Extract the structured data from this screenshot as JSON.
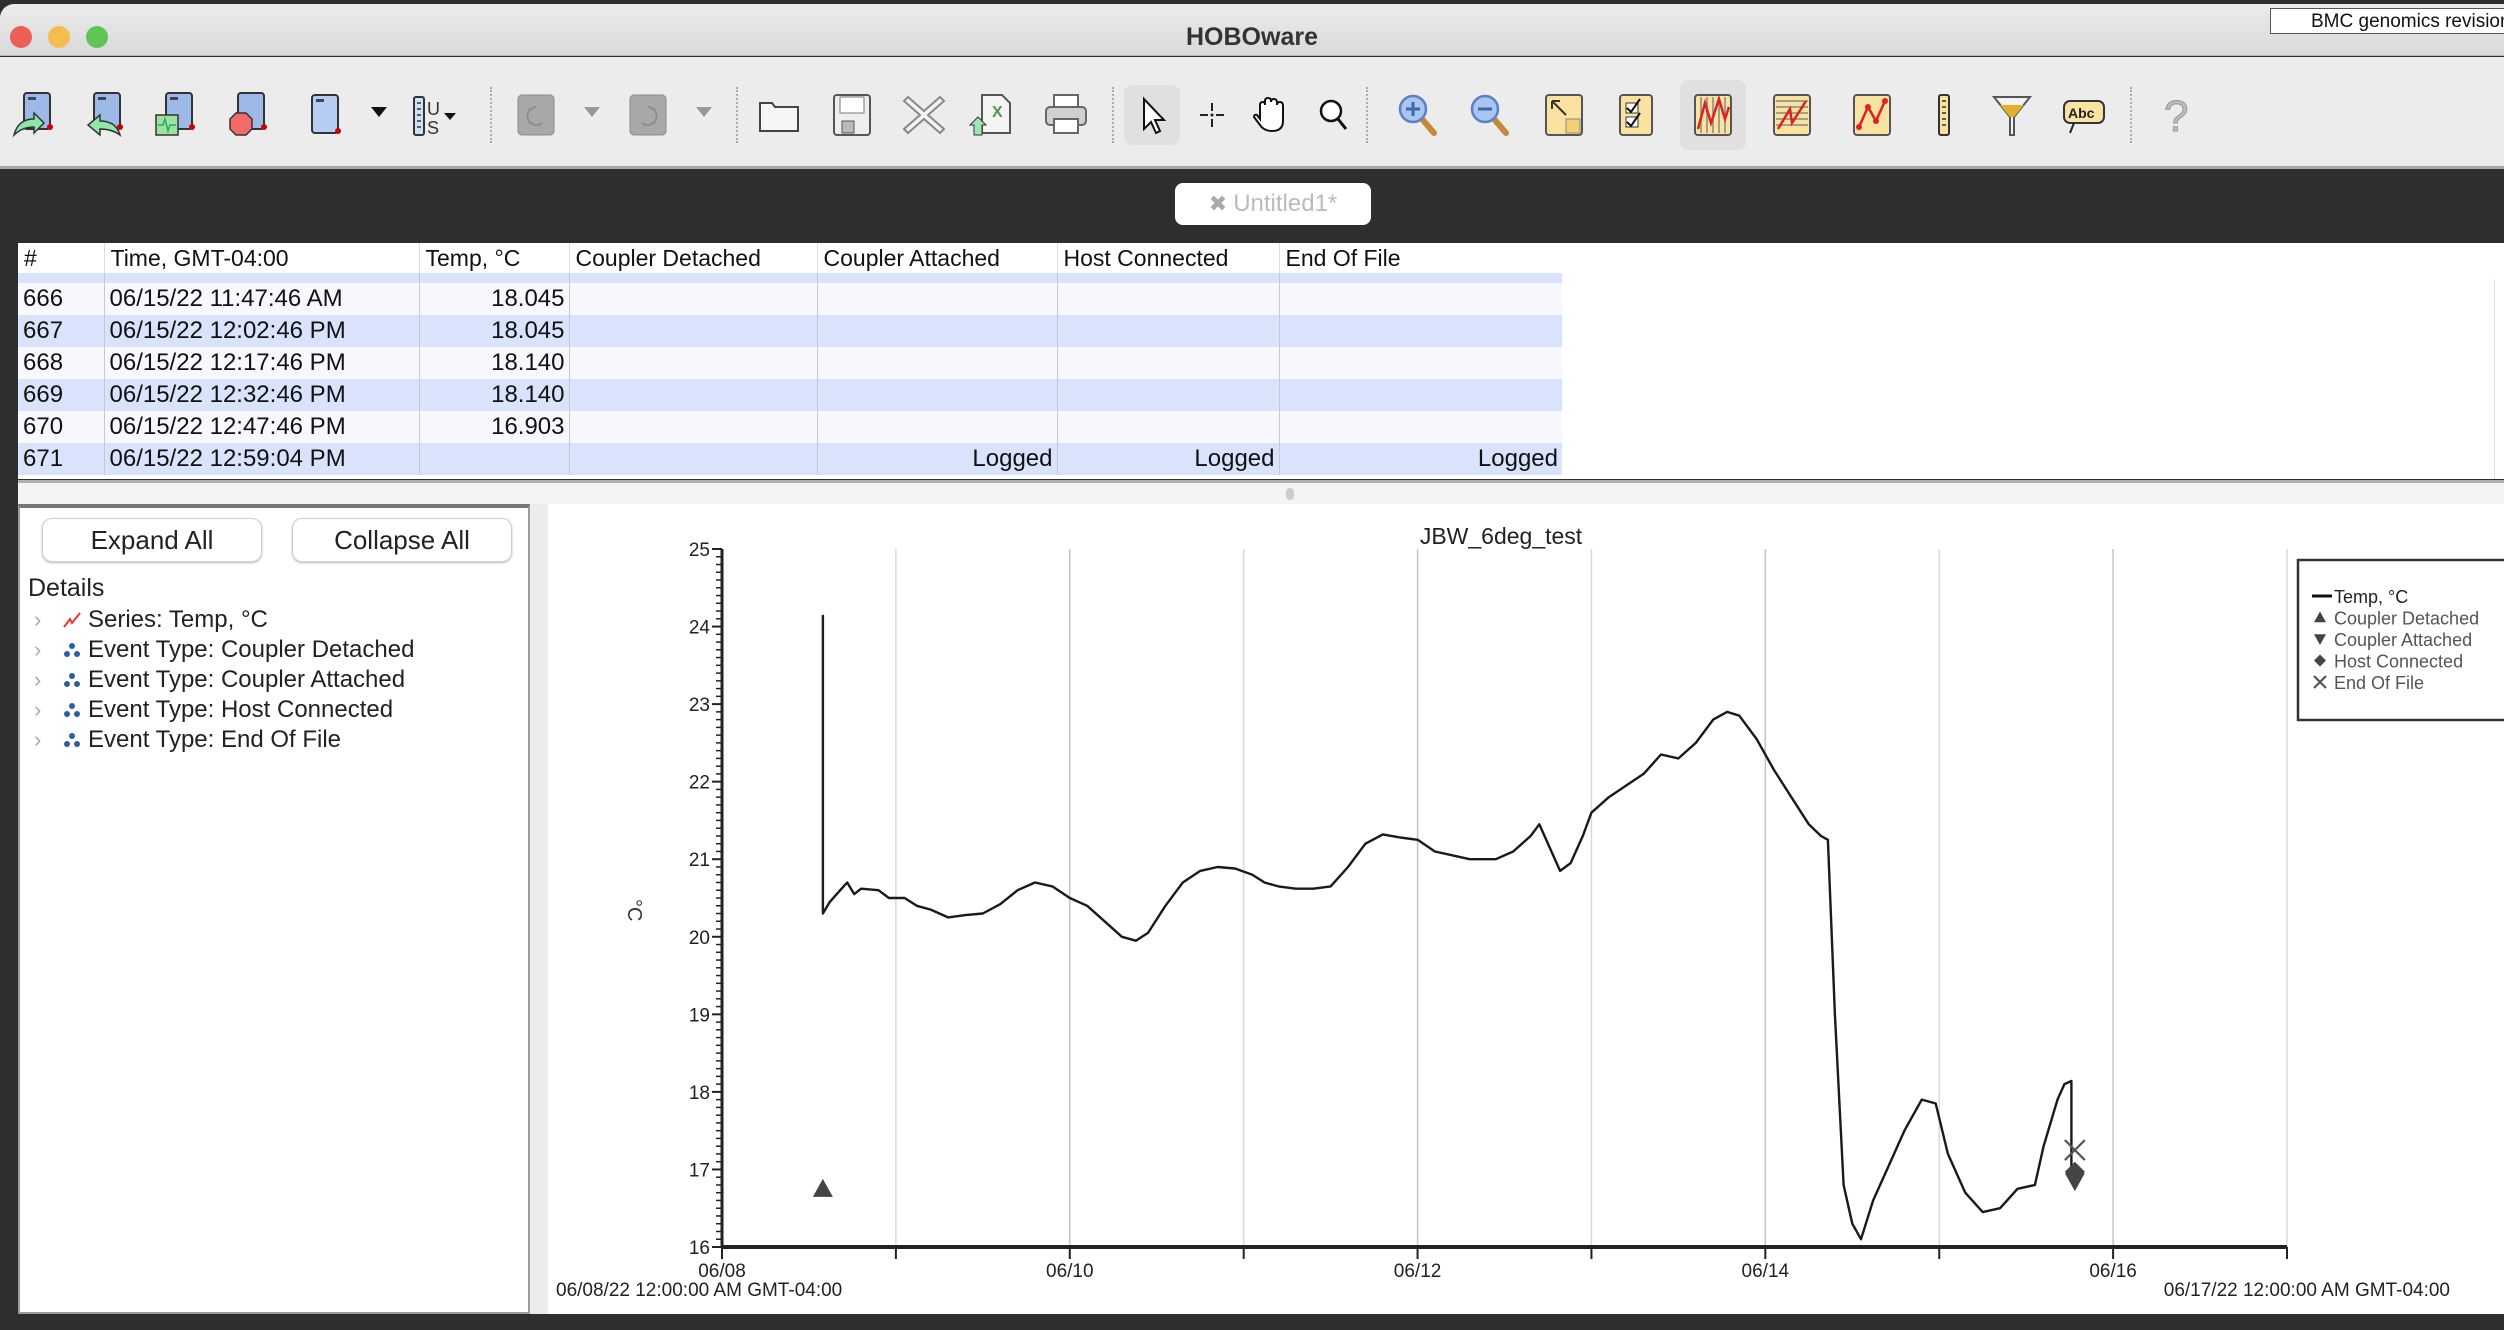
{
  "window": {
    "title": "HOBOware",
    "overlay_label": "BMC genomics revision",
    "traffic_lights": {
      "close": "#ec5f57",
      "minimize": "#f4bd4f",
      "zoom": "#5fc454"
    }
  },
  "toolbar": {
    "buttons": [
      {
        "name": "launch-logger-icon",
        "tooltip": "Launch"
      },
      {
        "name": "readout-logger-icon",
        "tooltip": "Readout"
      },
      {
        "name": "status-icon",
        "tooltip": "Status"
      },
      {
        "name": "stop-logger-icon",
        "tooltip": "Stop"
      },
      {
        "name": "device-icon",
        "tooltip": "Device"
      },
      {
        "name": "units-icon",
        "tooltip": "Units",
        "label": "US"
      },
      {
        "name": "undo-icon",
        "tooltip": "Undo",
        "disabled": true
      },
      {
        "name": "redo-icon",
        "tooltip": "Redo",
        "disabled": true
      },
      {
        "name": "open-folder-icon",
        "tooltip": "Open"
      },
      {
        "name": "save-icon",
        "tooltip": "Save"
      },
      {
        "name": "close-file-icon",
        "tooltip": "Close"
      },
      {
        "name": "export-excel-icon",
        "tooltip": "Export"
      },
      {
        "name": "print-icon",
        "tooltip": "Print"
      },
      {
        "name": "pointer-tool-icon",
        "tooltip": "Pointer",
        "selected": true
      },
      {
        "name": "crosshair-tool-icon",
        "tooltip": "Crosshair"
      },
      {
        "name": "hand-tool-icon",
        "tooltip": "Pan"
      },
      {
        "name": "magnifier-tool-icon",
        "tooltip": "Zoom box"
      },
      {
        "name": "zoom-in-icon",
        "tooltip": "Zoom in"
      },
      {
        "name": "zoom-out-icon",
        "tooltip": "Zoom out"
      },
      {
        "name": "zoom-fit-icon",
        "tooltip": "Fit"
      },
      {
        "name": "checklist-icon",
        "tooltip": "Series"
      },
      {
        "name": "vertical-grid-icon",
        "tooltip": "Vertical grid",
        "selected": true
      },
      {
        "name": "horizontal-grid-icon",
        "tooltip": "Horizontal grid"
      },
      {
        "name": "data-points-icon",
        "tooltip": "Points"
      },
      {
        "name": "ruler-icon",
        "tooltip": "Ruler"
      },
      {
        "name": "filter-icon",
        "tooltip": "Filter"
      },
      {
        "name": "annotation-icon",
        "tooltip": "Annotation",
        "label": "Abc"
      },
      {
        "name": "help-icon",
        "tooltip": "Help",
        "label": "?"
      }
    ]
  },
  "document_tab": {
    "label": "Untitled1*"
  },
  "table": {
    "columns": [
      "#",
      "Time, GMT-04:00",
      "Temp, °C",
      "Coupler Detached",
      "Coupler Attached",
      "Host Connected",
      "End Of File"
    ],
    "rows": [
      [
        "666",
        "06/15/22 11:47:46 AM",
        "18.045",
        "",
        "",
        "",
        ""
      ],
      [
        "667",
        "06/15/22 12:02:46 PM",
        "18.045",
        "",
        "",
        "",
        ""
      ],
      [
        "668",
        "06/15/22 12:17:46 PM",
        "18.140",
        "",
        "",
        "",
        ""
      ],
      [
        "669",
        "06/15/22 12:32:46 PM",
        "18.140",
        "",
        "",
        "",
        ""
      ],
      [
        "670",
        "06/15/22 12:47:46 PM",
        "16.903",
        "",
        "",
        "",
        ""
      ],
      [
        "671",
        "06/15/22 12:59:04 PM",
        "",
        "",
        "Logged",
        "Logged",
        "Logged"
      ]
    ]
  },
  "details_panel": {
    "expand_all": "Expand All",
    "collapse_all": "Collapse All",
    "heading": "Details",
    "items": [
      {
        "label": "Series: Temp, °C",
        "icon": "series-line-icon"
      },
      {
        "label": "Event Type: Coupler Detached",
        "icon": "event-type-icon"
      },
      {
        "label": "Event Type: Coupler Attached",
        "icon": "event-type-icon"
      },
      {
        "label": "Event Type: Host Connected",
        "icon": "event-type-icon"
      },
      {
        "label": "Event Type: End Of File",
        "icon": "event-type-icon"
      }
    ]
  },
  "chart_data": {
    "type": "line",
    "title": "JBW_6deg_test",
    "xlabel": "",
    "ylabel": "°C",
    "x_unit": "days since 06/08/22 12:00:00 AM",
    "xlim": [
      0,
      9
    ],
    "ylim": [
      16,
      25
    ],
    "x_start_label": "06/08/22 12:00:00 AM GMT-04:00",
    "x_end_label": "06/17/22 12:00:00 AM GMT-04:00",
    "x_ticks": [
      {
        "x": 0,
        "label": "06/08"
      },
      {
        "x": 2,
        "label": "06/10"
      },
      {
        "x": 4,
        "label": "06/12"
      },
      {
        "x": 6,
        "label": "06/14"
      },
      {
        "x": 8,
        "label": "06/16"
      }
    ],
    "x_minor_ticks": [
      1,
      3,
      5,
      7,
      9
    ],
    "y_ticks": [
      16,
      17,
      18,
      19,
      20,
      21,
      22,
      23,
      24,
      25
    ],
    "grid": "vertical",
    "legend_position": "top-right",
    "legend": [
      {
        "label": "Temp, °C",
        "marker": "line"
      },
      {
        "label": "Coupler Detached",
        "marker": "triangle-up"
      },
      {
        "label": "Coupler Attached",
        "marker": "triangle-down"
      },
      {
        "label": "Host Connected",
        "marker": "diamond"
      },
      {
        "label": "End Of File",
        "marker": "x"
      }
    ],
    "series": [
      {
        "name": "Temp, °C",
        "points": [
          [
            0.58,
            24.15
          ],
          [
            0.58,
            20.3
          ],
          [
            0.62,
            20.45
          ],
          [
            0.68,
            20.6
          ],
          [
            0.72,
            20.7
          ],
          [
            0.76,
            20.55
          ],
          [
            0.8,
            20.62
          ],
          [
            0.9,
            20.6
          ],
          [
            0.96,
            20.5
          ],
          [
            1.05,
            20.5
          ],
          [
            1.12,
            20.4
          ],
          [
            1.2,
            20.35
          ],
          [
            1.3,
            20.25
          ],
          [
            1.4,
            20.28
          ],
          [
            1.5,
            20.3
          ],
          [
            1.6,
            20.42
          ],
          [
            1.7,
            20.6
          ],
          [
            1.8,
            20.7
          ],
          [
            1.9,
            20.65
          ],
          [
            2.0,
            20.5
          ],
          [
            2.1,
            20.4
          ],
          [
            2.2,
            20.2
          ],
          [
            2.3,
            20.0
          ],
          [
            2.38,
            19.95
          ],
          [
            2.45,
            20.05
          ],
          [
            2.55,
            20.4
          ],
          [
            2.65,
            20.7
          ],
          [
            2.75,
            20.85
          ],
          [
            2.85,
            20.9
          ],
          [
            2.95,
            20.88
          ],
          [
            3.05,
            20.8
          ],
          [
            3.12,
            20.7
          ],
          [
            3.2,
            20.65
          ],
          [
            3.3,
            20.62
          ],
          [
            3.4,
            20.62
          ],
          [
            3.5,
            20.65
          ],
          [
            3.6,
            20.9
          ],
          [
            3.7,
            21.2
          ],
          [
            3.8,
            21.32
          ],
          [
            3.9,
            21.28
          ],
          [
            4.0,
            21.25
          ],
          [
            4.1,
            21.1
          ],
          [
            4.2,
            21.05
          ],
          [
            4.3,
            21.0
          ],
          [
            4.45,
            21.0
          ],
          [
            4.55,
            21.1
          ],
          [
            4.65,
            21.3
          ],
          [
            4.7,
            21.45
          ],
          [
            4.75,
            21.2
          ],
          [
            4.82,
            20.85
          ],
          [
            4.88,
            20.95
          ],
          [
            4.95,
            21.3
          ],
          [
            5.0,
            21.6
          ],
          [
            5.1,
            21.8
          ],
          [
            5.2,
            21.95
          ],
          [
            5.3,
            22.1
          ],
          [
            5.4,
            22.35
          ],
          [
            5.5,
            22.3
          ],
          [
            5.6,
            22.5
          ],
          [
            5.7,
            22.8
          ],
          [
            5.78,
            22.9
          ],
          [
            5.85,
            22.85
          ],
          [
            5.95,
            22.55
          ],
          [
            6.05,
            22.15
          ],
          [
            6.15,
            21.8
          ],
          [
            6.25,
            21.45
          ],
          [
            6.32,
            21.3
          ],
          [
            6.36,
            21.25
          ],
          [
            6.4,
            19.0
          ],
          [
            6.45,
            16.8
          ],
          [
            6.5,
            16.3
          ],
          [
            6.55,
            16.1
          ],
          [
            6.62,
            16.6
          ],
          [
            6.7,
            17.0
          ],
          [
            6.8,
            17.5
          ],
          [
            6.9,
            17.9
          ],
          [
            6.98,
            17.85
          ],
          [
            7.05,
            17.2
          ],
          [
            7.15,
            16.7
          ],
          [
            7.25,
            16.45
          ],
          [
            7.35,
            16.5
          ],
          [
            7.45,
            16.75
          ],
          [
            7.55,
            16.8
          ],
          [
            7.6,
            17.3
          ],
          [
            7.68,
            17.9
          ],
          [
            7.72,
            18.1
          ],
          [
            7.76,
            18.14
          ],
          [
            7.76,
            16.9
          ]
        ]
      }
    ],
    "events": [
      {
        "type": "Coupler Detached",
        "marker": "triangle-up",
        "x": 0.58,
        "y": 16.75
      },
      {
        "type": "End Of File",
        "marker": "x",
        "x": 7.78,
        "y": 17.25
      },
      {
        "type": "Host Connected",
        "marker": "diamond",
        "x": 7.78,
        "y": 16.97
      },
      {
        "type": "Coupler Attached",
        "marker": "triangle-down",
        "x": 7.78,
        "y": 16.85
      }
    ]
  }
}
